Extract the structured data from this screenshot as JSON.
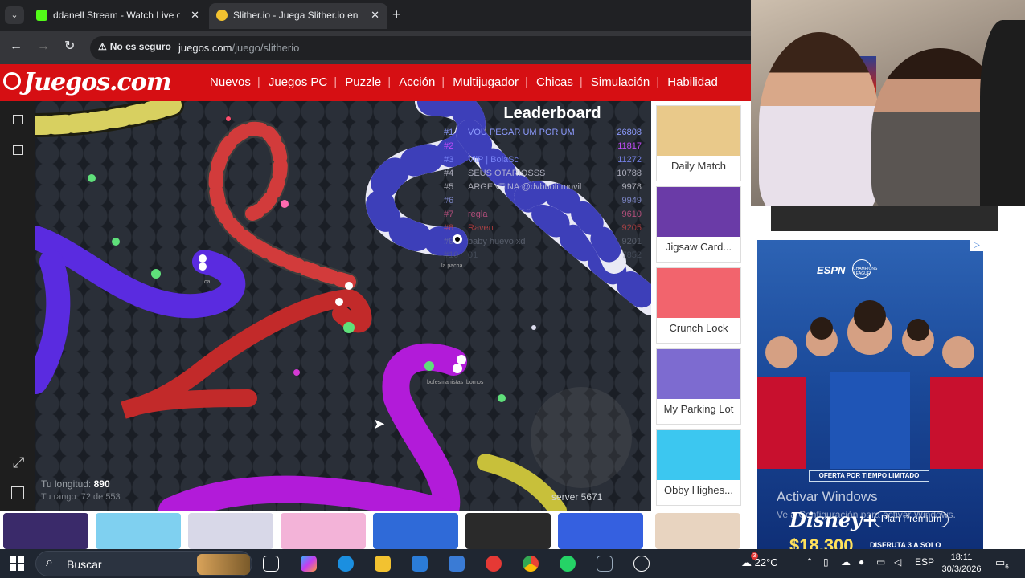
{
  "browser": {
    "tabs": [
      {
        "title": "ddanell Stream - Watch Live on",
        "favicon_color": "#53fc18",
        "active": false
      },
      {
        "title": "Slither.io - Juega Slither.io en Ju",
        "favicon_color": "#f2c230",
        "active": true
      }
    ],
    "security_label": "No es seguro",
    "url_host": "juegos.com",
    "url_path": "/juego/slitherio"
  },
  "site": {
    "logo_text": "Juegos.com",
    "nav": [
      "Nuevos",
      "Juegos PC",
      "Puzzle",
      "Acción",
      "Multijugador",
      "Chicas",
      "Simulación",
      "Habilidad"
    ]
  },
  "game": {
    "leaderboard_title": "Leaderboard",
    "leaderboard": [
      {
        "rank": "#1",
        "name": "VOU PEGAR UM POR UM",
        "score": "26808",
        "color": "#8d9bff"
      },
      {
        "rank": "#2",
        "name": "",
        "score": "11817",
        "color": "#c84dff"
      },
      {
        "rank": "#3",
        "name": "ViiP | BolaSc",
        "score": "11272",
        "color": "#7f8cff"
      },
      {
        "rank": "#4",
        "name": "SEUS OTARIOSSS",
        "score": "10788",
        "color": "#c6c6d6"
      },
      {
        "rank": "#5",
        "name": "ARGENTINA @dvbboli movil",
        "score": "9978",
        "color": "#d5d5e0"
      },
      {
        "rank": "#6",
        "name": "",
        "score": "9949",
        "color": "#9da8ff"
      },
      {
        "rank": "#7",
        "name": "regla",
        "score": "9610",
        "color": "#ff5fa0"
      },
      {
        "rank": "#8",
        "name": "Raven",
        "score": "9205",
        "color": "#ff4d4d"
      },
      {
        "rank": "#9",
        "name": "baby huevo xd",
        "score": "9201",
        "color": "#808898"
      },
      {
        "rank": "#10",
        "name": "01",
        "score": "7852",
        "color": "#606878"
      }
    ],
    "length_label": "Tu longitud:",
    "length_value": "890",
    "rank_text": "Tu rango: 72 de 553",
    "server": "server 5671",
    "snake_names": [
      "la pacha",
      "ca",
      "bofesmanistas",
      "bornos"
    ]
  },
  "side_games": [
    {
      "name": "Daily Match",
      "color": "#e9c98a"
    },
    {
      "name": "Jigsaw Card...",
      "color": "#6a3ba7"
    },
    {
      "name": "Crunch Lock",
      "color": "#f2646d"
    },
    {
      "name": "My Parking Lot",
      "color": "#7d6bd0"
    },
    {
      "name": "Obby Highes...",
      "color": "#3cc7f0"
    },
    {
      "name": "",
      "color": "#e8d4c0"
    }
  ],
  "bottom_games": [
    "#3a2a6a",
    "#7fd0f0",
    "#f2f2f2",
    "#f3b3d8",
    "#2f6ad8",
    "#2a2a2a",
    "#3560e0"
  ],
  "ad": {
    "espn": "ESPN",
    "league": "CHAMPIONS LEAGUE",
    "offer": "OFERTA POR TIEMPO LIMITADO",
    "watermark_title": "Activar Windows",
    "watermark_sub": "Ve a Configuración para activar Windows.",
    "brand": "Disney+",
    "plan": "Plan Premium",
    "price": "$18.300",
    "price_note": "DISFRUTA 3 A SOLO"
  },
  "taskbar": {
    "search_placeholder": "Buscar",
    "temperature": "22°C",
    "weather_badge": "3",
    "language": "ESP",
    "time": "18:11",
    "date": "30/3/2026",
    "notifications": "6"
  }
}
